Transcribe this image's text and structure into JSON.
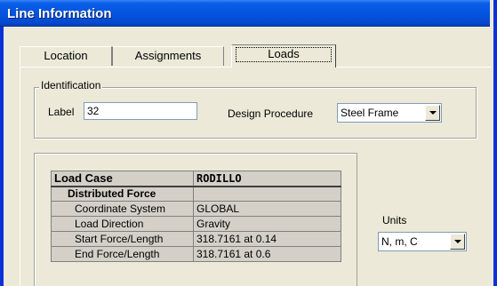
{
  "window": {
    "title": "Line Information"
  },
  "tabs": [
    {
      "label": "Location"
    },
    {
      "label": "Assignments"
    },
    {
      "label": "Loads",
      "active": true
    }
  ],
  "identification": {
    "group_title": "Identification",
    "label_caption": "Label",
    "label_value": "32",
    "design_caption": "Design Procedure",
    "design_value": "Steel Frame"
  },
  "load_table": {
    "header": [
      "Load Case",
      "RODILLO"
    ],
    "section": "Distributed Force",
    "rows": [
      {
        "name": "Coordinate System",
        "value": "GLOBAL"
      },
      {
        "name": "Load Direction",
        "value": "Gravity"
      },
      {
        "name": "Start Force/Length",
        "value": "318.7161 at 0.14"
      },
      {
        "name": "End Force/Length",
        "value": "318.7161 at 0.6"
      }
    ]
  },
  "units": {
    "caption": "Units",
    "value": "N, m, C"
  }
}
